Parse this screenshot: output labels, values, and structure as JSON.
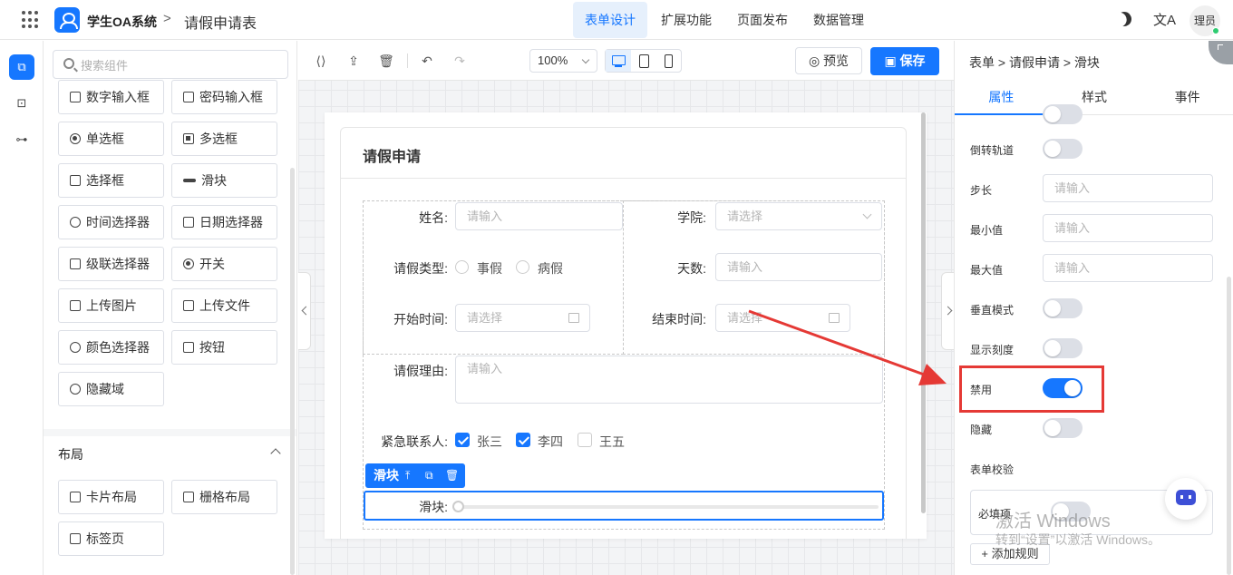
{
  "header": {
    "app_title": "学生OA系统",
    "separator": ">",
    "page_title": "请假申请表",
    "nav": [
      "表单设计",
      "扩展功能",
      "页面发布",
      "数据管理"
    ],
    "active_nav": "表单设计",
    "translate_glyph": "文A",
    "user": "理员"
  },
  "components": {
    "search_placeholder": "搜索组件",
    "items": [
      "数字输入框",
      "密码输入框",
      "单选框",
      "多选框",
      "选择框",
      "滑块",
      "时间选择器",
      "日期选择器",
      "级联选择器",
      "开关",
      "上传图片",
      "上传文件",
      "颜色选择器",
      "按钮",
      "隐藏域"
    ],
    "layout_title": "布局",
    "layout_items": [
      "卡片布局",
      "栅格布局",
      "标签页"
    ]
  },
  "toolbar": {
    "zoom": "100%",
    "preview": "预览",
    "save": "保存"
  },
  "form": {
    "card_title": "请假申请",
    "name_label": "姓名:",
    "name_placeholder": "请输入",
    "college_label": "学院:",
    "college_placeholder": "请选择",
    "leave_type_label": "请假类型:",
    "leave_type_options": [
      "事假",
      "病假"
    ],
    "days_label": "天数:",
    "days_placeholder": "请输入",
    "start_label": "开始时间:",
    "start_placeholder": "请选择",
    "end_label": "结束时间:",
    "end_placeholder": "请选择",
    "reason_label": "请假理由:",
    "reason_placeholder": "请输入",
    "contact_label": "紧急联系人:",
    "contacts": [
      {
        "name": "张三",
        "checked": true
      },
      {
        "name": "李四",
        "checked": true
      },
      {
        "name": "王五",
        "checked": false
      }
    ],
    "slider_tag": "滑块",
    "slider_label": "滑块:",
    "slider_value": 0
  },
  "props": {
    "breadcrumb": "表单 > 请假申请 > 滑块",
    "tabs": [
      "属性",
      "样式",
      "事件"
    ],
    "active_tab": "属性",
    "reverse_track": {
      "label": "倒转轨道",
      "on": false
    },
    "step": {
      "label": "步长",
      "placeholder": "请输入"
    },
    "min": {
      "label": "最小值",
      "placeholder": "请输入"
    },
    "max": {
      "label": "最大值",
      "placeholder": "请输入"
    },
    "vertical": {
      "label": "垂直模式",
      "on": false
    },
    "show_ticks": {
      "label": "显示刻度",
      "on": false
    },
    "disabled": {
      "label": "禁用",
      "on": true
    },
    "hidden": {
      "label": "隐藏",
      "on": false
    },
    "validation_title": "表单校验",
    "required": {
      "label": "必填项",
      "on": false
    },
    "add_rule": "+ 添加规则"
  },
  "watermark": {
    "line1": "激活 Windows",
    "line2": "转到“设置”以激活 Windows。"
  },
  "colors": {
    "accent": "#1677ff",
    "annotation": "#e53935"
  }
}
